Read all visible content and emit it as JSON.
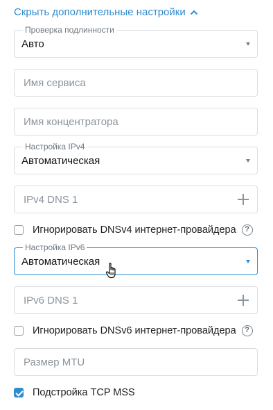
{
  "toggle": {
    "label": "Скрыть дополнительные настройки",
    "icon": "chevron-up-icon"
  },
  "auth": {
    "label": "Проверка подлинности",
    "value": "Авто"
  },
  "service_name": {
    "placeholder": "Имя сервиса"
  },
  "concentrator_name": {
    "placeholder": "Имя концентратора"
  },
  "ipv4_setting": {
    "label": "Настройка IPv4",
    "value": "Автоматическая"
  },
  "ipv4_dns1": {
    "placeholder": "IPv4 DNS 1",
    "icon": "plus-icon"
  },
  "ignore_dnsv4": {
    "label": "Игнорировать DNSv4 интернет-провайдера",
    "checked": false,
    "help_icon": "?"
  },
  "ipv6_setting": {
    "label": "Настройка IPv6",
    "value": "Автоматическая"
  },
  "ipv6_dns1": {
    "placeholder": "IPv6 DNS 1",
    "icon": "plus-icon"
  },
  "ignore_dnsv6": {
    "label": "Игнорировать DNSv6 интернет-провайдера",
    "checked": false,
    "help_icon": "?"
  },
  "mtu": {
    "placeholder": "Размер MTU"
  },
  "tcp_mss": {
    "label": "Подстройка TCP MSS",
    "checked": true
  },
  "colors": {
    "accent": "#2e8ccf",
    "border": "#d9dde1",
    "placeholder": "#8c949c"
  }
}
